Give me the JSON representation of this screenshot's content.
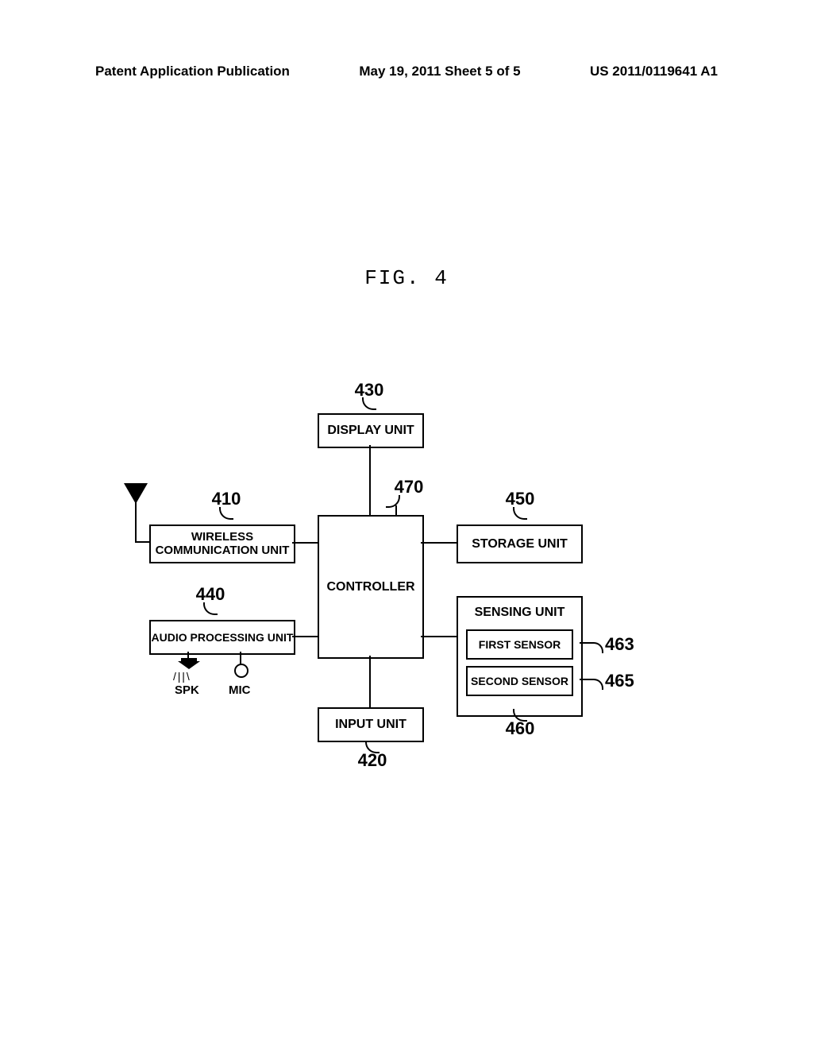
{
  "header": {
    "left": "Patent Application Publication",
    "center": "May 19, 2011  Sheet 5 of 5",
    "right": "US 2011/0119641 A1"
  },
  "figure_title": "FIG. 4",
  "refs": {
    "wireless": "410",
    "input": "420",
    "display": "430",
    "audio": "440",
    "storage": "450",
    "sensing": "460",
    "first_sensor": "463",
    "second_sensor": "465",
    "controller": "470"
  },
  "blocks": {
    "display": "DISPLAY UNIT",
    "wireless": "WIRELESS COMMUNICATION UNIT",
    "controller": "CONTROLLER",
    "storage": "STORAGE UNIT",
    "audio": "AUDIO PROCESSING UNIT",
    "sensing": "SENSING UNIT",
    "first_sensor": "FIRST SENSOR",
    "second_sensor": "SECOND SENSOR",
    "input": "INPUT UNIT"
  },
  "audio_labels": {
    "spk": "SPK",
    "mic": "MIC"
  }
}
